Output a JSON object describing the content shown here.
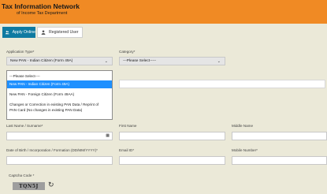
{
  "header": {
    "title": "Tax Information Network",
    "subtitle": "of Income Tax Department"
  },
  "tabs": [
    {
      "label": "Apply Online",
      "icon": "users-icon"
    },
    {
      "label": "Registered User",
      "icon": "user-icon"
    }
  ],
  "form": {
    "application_type_label": "Application Type*",
    "application_type_value": "New PAN - Indian Citizen (Form 49A)",
    "category_label": "Category*",
    "category_value": "---Please Select-----",
    "application_type_options": [
      {
        "label": "---Please Select----",
        "selected": false
      },
      {
        "label": "New PAN - Indian Citizen (Form 49A)",
        "selected": true
      },
      {
        "label": "New PAN - Foreign Citizen (Form 49AA)",
        "selected": false
      },
      {
        "label": "Changes or Correction in existing PAN Data / Reprint of PAN Card (No changes in existing PAN Data)",
        "line1": "Changes or Correction in existing PAN Data / Reprint of",
        "line2": "PAN Card (No changes in existing PAN Data)",
        "selected": false
      }
    ],
    "last_name_label": "Last Name / Surname*",
    "first_name_label": "First Name",
    "middle_name_label": "Middle Name",
    "dob_label": "Date of Birth / Incorporation / Formation (DD/MM/YYYY)*",
    "email_label": "Email ID*",
    "mobile_label": "Mobile Number*",
    "captcha_label": "Captcha Code *",
    "captcha_text": "TQN5J"
  }
}
